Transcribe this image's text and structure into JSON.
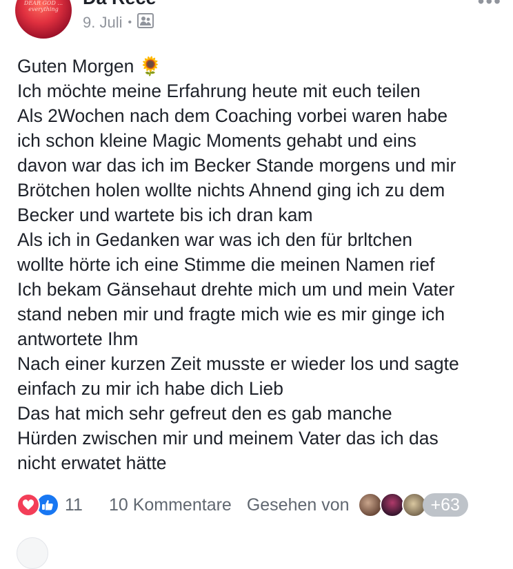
{
  "post": {
    "author": "Da Rece",
    "date": "9. Juli",
    "avatar_text": "DEAR GOD ... everything",
    "lines": [
      "Guten Morgen 🌻",
      "Ich möchte meine Erfahrung heute mit euch teilen",
      "Als 2Wochen nach dem Coaching vorbei waren habe",
      "ich schon kleine Magic Moments gehabt und eins",
      "davon war das ich im Becker Stande morgens und mir",
      "Brötchen holen wollte nichts Ahnend ging ich zu dem",
      "Becker und wartete bis ich dran kam",
      "Als ich in Gedanken war was ich den für brltchen",
      "wollte hörte ich eine Stimme die meinen Namen rief",
      "Ich bekam Gänsehaut drehte mich um und mein Vater",
      "stand neben mir und fragte mich wie es mir ginge ich",
      "antwortete Ihm",
      "Nach einer kurzen Zeit musste er wieder los und sagte",
      "einfach zu mir ich habe dich Lieb",
      "Das hat mich sehr gefreut den  es gab manche",
      "Hürden zwischen mir und meinem Vater das ich das",
      "nicht erwatet hätte"
    ]
  },
  "footer": {
    "reaction_count": "11",
    "comments": "10 Kommentare",
    "seen_by": "Gesehen von",
    "more_viewers": "+63"
  },
  "colors": {
    "text": "#1d2129",
    "meta": "#90949c",
    "love": "#f33e58",
    "like": "#1877f2"
  }
}
